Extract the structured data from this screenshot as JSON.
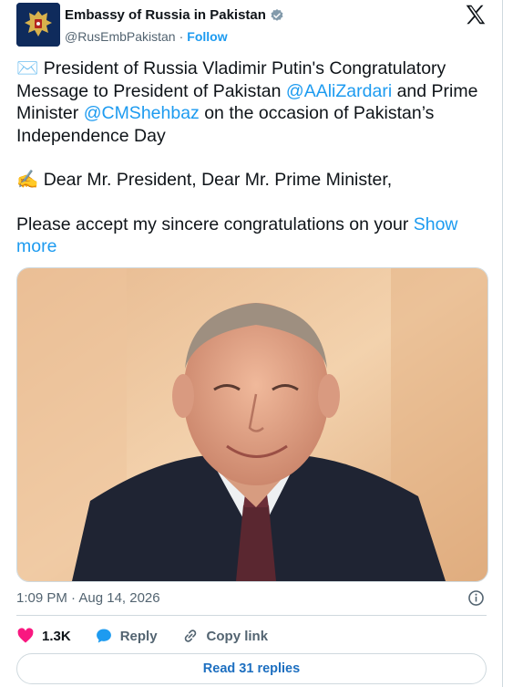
{
  "account": {
    "name": "Embassy of Russia in Pakistan",
    "handle": "@RusEmbPakistan",
    "separator": "·",
    "follow_label": "Follow",
    "verified_icon": "verified-badge-icon",
    "platform_icon": "x-logo-icon"
  },
  "tweet": {
    "line1_emoji": "✉️",
    "line1_a": " President of Russia Vladimir Putin's Congratulatory Message to President of Pakistan ",
    "mention1": "@AAliZardari",
    "line1_b": " and Prime Minister ",
    "mention2": "@CMShehbaz",
    "line1_c": " on the occasion of Pakistan’s Independence Day",
    "line2_emoji": "✍️",
    "line2": " Dear Mr. President, Dear Mr. Prime Minister,",
    "line3": "Please accept my sincere congratulations on your ",
    "show_more": "Show more"
  },
  "meta": {
    "timestamp": "1:09 PM · Aug 14, 2026"
  },
  "actions": {
    "likes": "1.3K",
    "reply_label": "Reply",
    "copy_label": "Copy link",
    "read_replies": "Read 31 replies"
  },
  "colors": {
    "link": "#1d9bf0",
    "like": "#f91880",
    "reply": "#1d9bf0"
  }
}
